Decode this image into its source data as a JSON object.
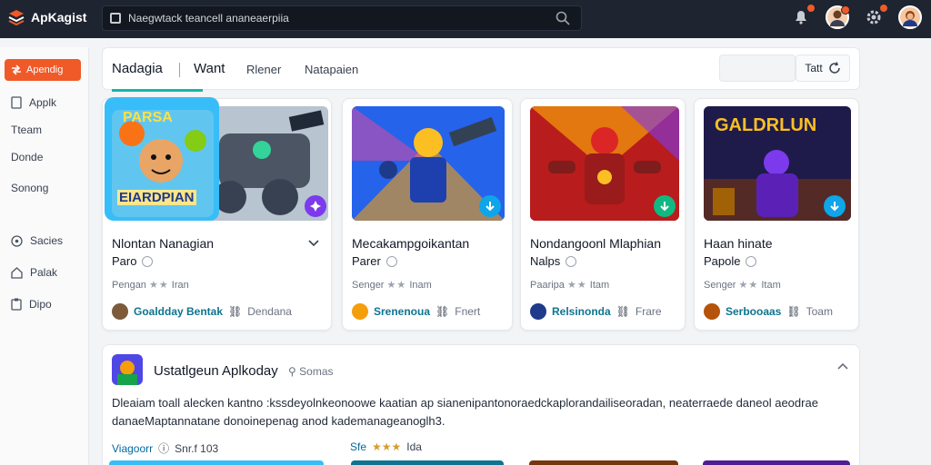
{
  "app": {
    "name": "ApKagist"
  },
  "search": {
    "value": "Naegwtack teancell ananeaerpiia"
  },
  "sidebar": {
    "primary": "Apendig",
    "items": [
      {
        "label": "Applk",
        "icon": "document-icon"
      },
      {
        "label": "Tteam",
        "icon": ""
      },
      {
        "label": "Donde",
        "icon": ""
      },
      {
        "label": "Sonong",
        "icon": ""
      },
      {
        "label": "Sacies",
        "icon": "settings-icon"
      },
      {
        "label": "Palak",
        "icon": "home-icon"
      },
      {
        "label": "Dipo",
        "icon": "clipboard-icon"
      }
    ]
  },
  "tabs": [
    {
      "label": "Nadagia"
    },
    {
      "label": "Want"
    },
    {
      "label": "Rlener"
    },
    {
      "label": "Natapaien"
    }
  ],
  "filter": {
    "button_label": "Tatt"
  },
  "cards": [
    {
      "title": "Nlontan Nanagian",
      "subtitle": "Paro",
      "meta_prefix": "Pengan",
      "stars": "★★",
      "meta_suffix": "Iran",
      "author": "Goaldday Bentak",
      "tag": "Dendana"
    },
    {
      "title": "Mecakampgoikantan",
      "subtitle": "Parer",
      "meta_prefix": "Senger",
      "stars": "★★",
      "meta_suffix": "Inam",
      "author": "Srenenoua",
      "tag": "Fnert"
    },
    {
      "title": "Nondangoonl Mlaphian",
      "subtitle": "Nalps",
      "meta_prefix": "Paaripa",
      "stars": "★★",
      "meta_suffix": "Itam",
      "author": "Relsinonda",
      "tag": "Frare"
    },
    {
      "title": "Haan hinate",
      "subtitle": "Papole",
      "meta_prefix": "Senger",
      "stars": "★★",
      "meta_suffix": "Itam",
      "author": "Serbooaas",
      "tag": "Toam"
    }
  ],
  "thumb_texts": {
    "card1_big": "EIARDPIAN",
    "card1_top": "PARSA",
    "card4_top": "GALDRLUN"
  },
  "details": {
    "title": "Ustatlgeun Aplkoday",
    "sub": "Somas",
    "description": "Dleaiam toall alecken kantno :kssdeyolnkeonoowe kaatian ap sianenipantonoraedckaplorandailiseoradan, neaterraede daneol aeodrae danaeMaptannatane donoinepenag anod kademanageanoglh3.",
    "meta": [
      {
        "link": "Viagoorr",
        "extra": "Snr.f 103"
      },
      {
        "link": "Sfe",
        "stars": "★★★",
        "extra": "Ida"
      }
    ]
  },
  "colors": {
    "accent": "#f05a28",
    "topbar": "#1f2431",
    "teal": "#14b8a6"
  }
}
